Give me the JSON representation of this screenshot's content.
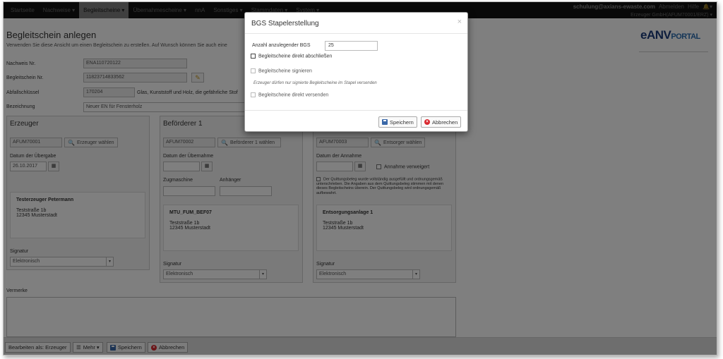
{
  "nav": {
    "items": [
      "Startseite",
      "Nachweise ▾",
      "Begleitscheine ▾",
      "Übernahmescheine ▾",
      "nnA",
      "Sonstiges ▾",
      "Stammdaten ▾",
      "System ▾"
    ],
    "user": "schulung@axians-ewaste.com",
    "logout": "Abmelden",
    "help": "Hilfe",
    "bell": "🔔▾",
    "account": "Erzeuger GmbH(AFUM70001/ERZ) ▾"
  },
  "page": {
    "title": "Begleitschein anlegen",
    "description": "Verwenden Sie diese Ansicht um einen Begleitschein zu erstellen. Auf Wunsch können Sie auch eine"
  },
  "logo": {
    "e": "e",
    "anv": "ANV",
    "portal": "PORTAL"
  },
  "form": {
    "nachweis_label": "Nachweis Nr.",
    "nachweis_value": "ENA110720122",
    "begleitschein_label": "Begleitschein Nr.",
    "begleitschein_value": "11823714833562",
    "abfall_label": "Abfallschlüssel",
    "abfall_value": "170204",
    "abfall_text": "Glas, Kunststoff und Holz, die gefährliche Stof",
    "bezeichnung_label": "Bezeichnung",
    "bezeichnung_value": "Neuer EN für Fensterholz"
  },
  "erzeuger": {
    "title": "Erzeuger",
    "id": "AFUM70001",
    "choose": "Erzeuger wählen",
    "date_label": "Datum der Übergabe",
    "date_value": "26.10.2017",
    "name": "Testerzeuger Petermann",
    "street": "Teststraße 1b",
    "city": "12345 Musterstadt",
    "sig_label": "Signatur",
    "sig_value": "Elektronisch"
  },
  "befoerderer": {
    "title": "Beförderer 1",
    "id": "AFUM70002",
    "choose": "Beförderer 1 wählen",
    "date_label": "Datum der Übernahme",
    "truck_label": "Zugmaschine",
    "trailer_label": "Anhänger",
    "name": "MTU_FUM_BEF07",
    "street": "Teststraße 1b",
    "city": "12345 Musterstadt",
    "sig_label": "Signatur",
    "sig_value": "Elektronisch"
  },
  "entsorger": {
    "id": "AFUM70003",
    "choose": "Entsorger wählen",
    "date_label": "Datum der Annahme",
    "refuse_label": "Annahme verweigert",
    "note": "Der Quittungsbeleg wurde vollständig ausgefüllt und ordnungsgemäß unterschrieben. Die Angaben aus dem Quittungsbeleg stimmen mit denen dieses Begleitscheins überein. Der Quittungsbeleg wird ordnungsgemäß aufbewahrt.",
    "name": "Entsorgungsanlage 1",
    "street": "Teststraße 1b",
    "city": "12345 Musterstadt",
    "sig_label": "Signatur",
    "sig_value": "Elektronisch"
  },
  "vermerke_label": "Vermerke",
  "bottom": {
    "edit_as": "Bearbeiten als: Erzeuger",
    "more": "Mehr ▾",
    "save": "Speichern",
    "cancel": "Abbrechen"
  },
  "modal": {
    "title": "BGS Stapelerstellung",
    "close": "×",
    "count_label": "Anzahl anzulegender BGS",
    "count_value": "25",
    "finish_label": "Begleitscheine direkt abschließen",
    "sign_label": "Begleitscheine signieren",
    "hint": "Erzeuger dürfen nur signierte Begleitscheine im Stapel versenden",
    "send_label": "Begleitscheine direkt versenden",
    "save": "Speichern",
    "cancel": "Abbrechen"
  }
}
